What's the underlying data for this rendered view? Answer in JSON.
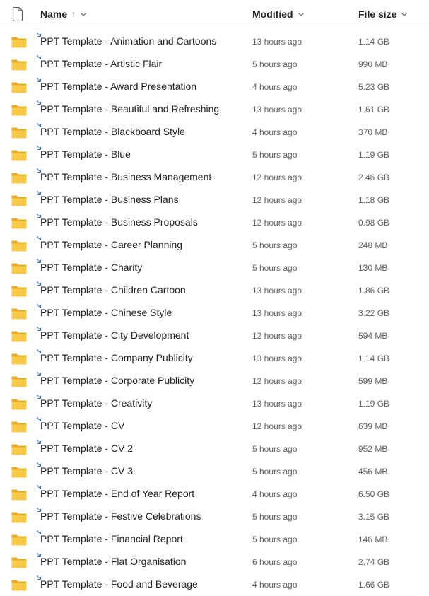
{
  "header": {
    "name_label": "Name",
    "name_sort_arrow": "↑",
    "modified_label": "Modified",
    "size_label": "File size"
  },
  "colors": {
    "folder": "#f8c848",
    "folder_dark": "#e8a820",
    "shared_badge": "#2b7cd3"
  },
  "files": [
    {
      "name": "PPT Template - Animation and Cartoons",
      "modified": "13 hours ago",
      "size": "1.14 GB"
    },
    {
      "name": "PPT Template - Artistic Flair",
      "modified": "5 hours ago",
      "size": "990 MB"
    },
    {
      "name": "PPT Template - Award Presentation",
      "modified": "4 hours ago",
      "size": "5.23 GB"
    },
    {
      "name": "PPT Template - Beautiful and Refreshing",
      "modified": "13 hours ago",
      "size": "1.61 GB"
    },
    {
      "name": "PPT Template - Blackboard Style",
      "modified": "4 hours ago",
      "size": "370 MB"
    },
    {
      "name": "PPT Template - Blue",
      "modified": "5 hours ago",
      "size": "1.19 GB"
    },
    {
      "name": "PPT Template - Business Management",
      "modified": "12 hours ago",
      "size": "2.46 GB"
    },
    {
      "name": "PPT Template - Business Plans",
      "modified": "12 hours ago",
      "size": "1.18 GB"
    },
    {
      "name": "PPT Template - Business Proposals",
      "modified": "12 hours ago",
      "size": "0.98 GB"
    },
    {
      "name": "PPT Template - Career Planning",
      "modified": "5 hours ago",
      "size": "248 MB"
    },
    {
      "name": "PPT Template - Charity",
      "modified": "5 hours ago",
      "size": "130 MB"
    },
    {
      "name": "PPT Template - Children Cartoon",
      "modified": "13 hours ago",
      "size": "1.86 GB"
    },
    {
      "name": "PPT Template - Chinese Style",
      "modified": "13 hours ago",
      "size": "3.22 GB"
    },
    {
      "name": "PPT Template - City Development",
      "modified": "12 hours ago",
      "size": "594 MB"
    },
    {
      "name": "PPT Template - Company Publicity",
      "modified": "13 hours ago",
      "size": "1.14 GB"
    },
    {
      "name": "PPT Template - Corporate Publicity",
      "modified": "12 hours ago",
      "size": "599 MB"
    },
    {
      "name": "PPT Template - Creativity",
      "modified": "13 hours ago",
      "size": "1.19 GB"
    },
    {
      "name": "PPT Template - CV",
      "modified": "12 hours ago",
      "size": "639 MB"
    },
    {
      "name": "PPT Template - CV 2",
      "modified": "5 hours ago",
      "size": "952 MB"
    },
    {
      "name": "PPT Template - CV 3",
      "modified": "5 hours ago",
      "size": "456 MB"
    },
    {
      "name": "PPT Template - End of Year Report",
      "modified": "4 hours ago",
      "size": "6.50 GB"
    },
    {
      "name": "PPT Template - Festive Celebrations",
      "modified": "5 hours ago",
      "size": "3.15 GB"
    },
    {
      "name": "PPT Template - Financial Report",
      "modified": "5 hours ago",
      "size": "146 MB"
    },
    {
      "name": "PPT Template - Flat Organisation",
      "modified": "6 hours ago",
      "size": "2.74 GB"
    },
    {
      "name": "PPT Template - Food and Beverage",
      "modified": "4 hours ago",
      "size": "1.66 GB"
    }
  ]
}
